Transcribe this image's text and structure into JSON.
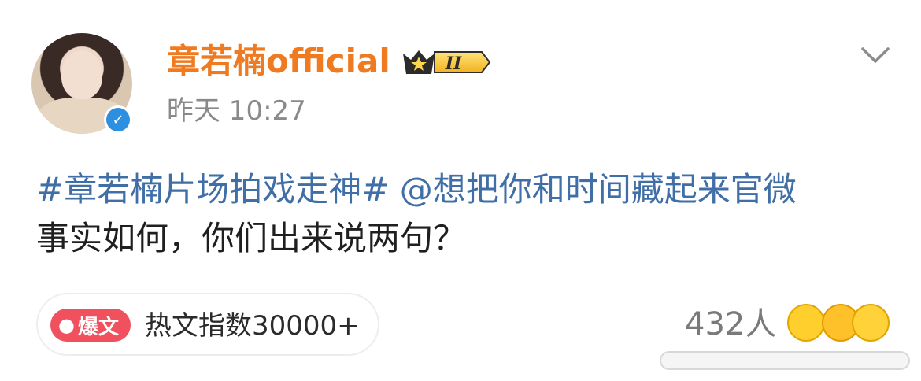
{
  "post": {
    "username": "章若楠official",
    "vip_level": "II",
    "timestamp": "昨天 10:27",
    "hashtag": "#章若楠片场拍戏走神#",
    "mention": "@想把你和时间藏起来官微",
    "body_text": "事实如何，你们出来说两句？"
  },
  "hot": {
    "tag_label": "爆文",
    "index_text": "热文指数30000+"
  },
  "reactions": {
    "count_text": "432人",
    "emojis": [
      "grinning-emoji",
      "kiss-emoji",
      "surprised-emoji"
    ]
  },
  "colors": {
    "username": "#f07a20",
    "link": "#3f6fa6",
    "hot_tag": "#f1505e",
    "verified": "#2d8fe0"
  }
}
